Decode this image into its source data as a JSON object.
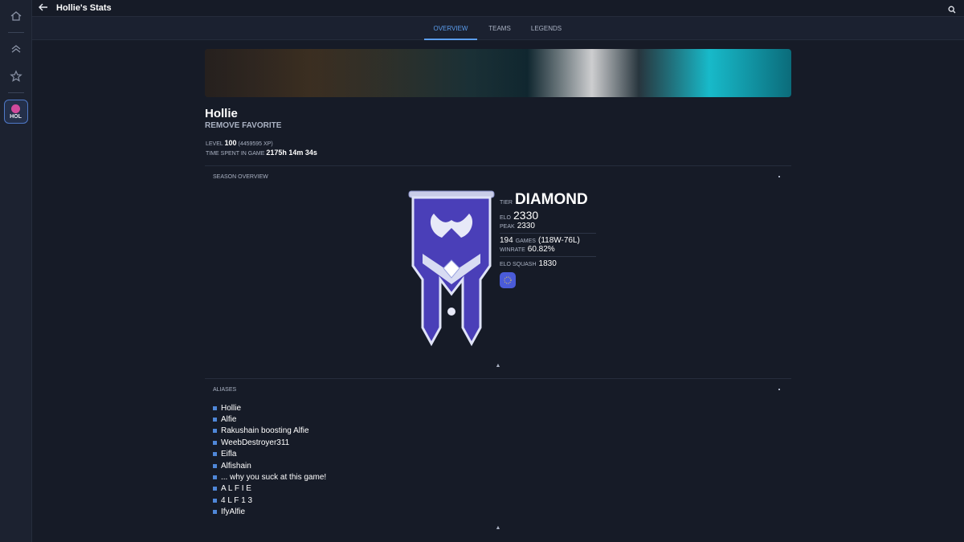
{
  "header": {
    "title": "Hollie's Stats"
  },
  "tabs": [
    {
      "label": "OVERVIEW",
      "active": true
    },
    {
      "label": "TEAMS",
      "active": false
    },
    {
      "label": "LEGENDS",
      "active": false
    }
  ],
  "sidebar": {
    "avatar_label": "HOL"
  },
  "player": {
    "name": "Hollie",
    "favorite_action": "REMOVE FAVORITE",
    "level_label": "LEVEL",
    "level": "100",
    "xp": "(4459595 XP)",
    "time_label": "TIME SPENT IN GAME",
    "time": "2175h 14m 34s"
  },
  "season": {
    "section_title": "SEASON OVERVIEW",
    "tier_label": "TIER",
    "tier": "DIAMOND",
    "elo_label": "ELO",
    "elo": "2330",
    "peak_label": "PEAK",
    "peak": "2330",
    "games": "194",
    "games_label": "GAMES",
    "record": "(118W-76L)",
    "winrate_label": "WINRATE",
    "winrate": "60.82%",
    "squash_label": "ELO SQUASH",
    "squash": "1830"
  },
  "aliases": {
    "section_title": "ALIASES",
    "items": [
      "Hollie",
      "Alfie",
      "Rakushain boosting Alfie",
      "WeebDestroyer311",
      "Eifla",
      "Alfishain",
      "... why you suck at this game!",
      "A L F I E",
      "4 L F 1 3",
      "IfyAlfie"
    ]
  },
  "colors": {
    "accent": "#5b9ded",
    "background": "#161b27",
    "diamond": "#4a4fc8"
  }
}
